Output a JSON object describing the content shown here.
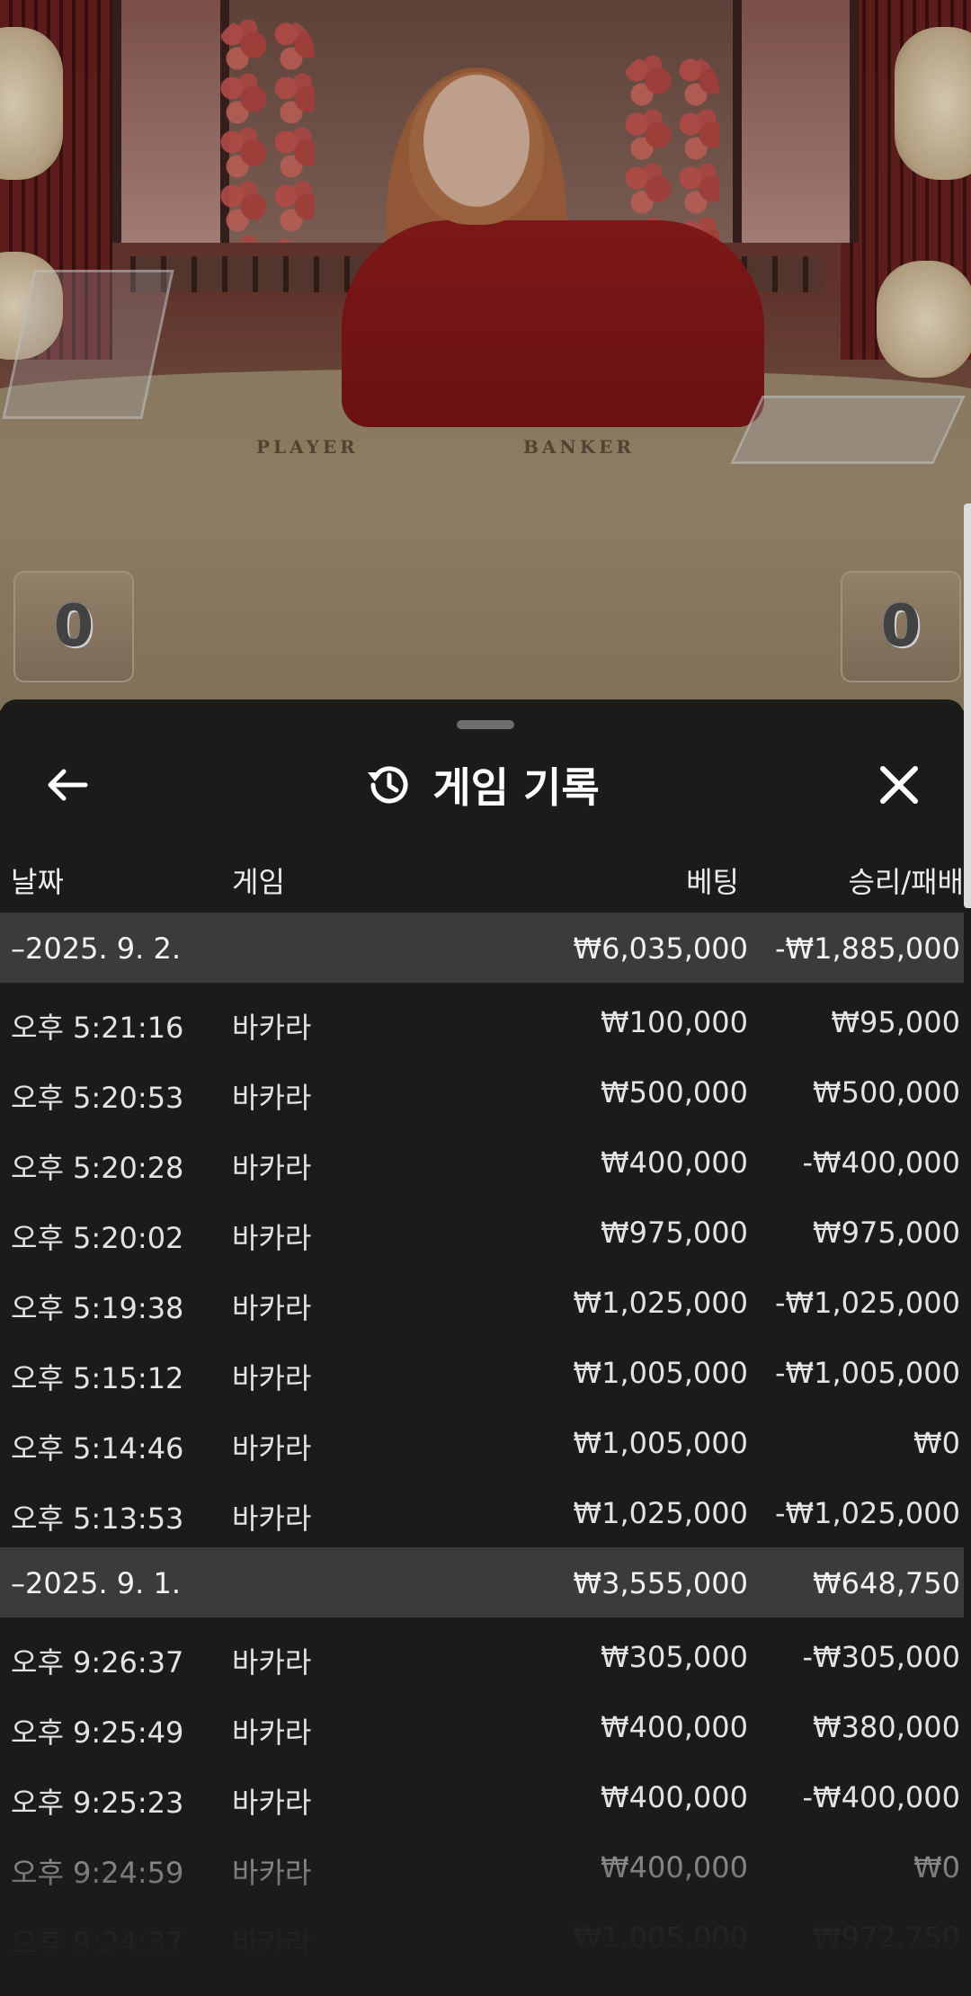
{
  "video": {
    "label_player": "PLAYER",
    "label_banker": "BANKER",
    "score_player": "0",
    "score_banker": "0"
  },
  "sheet": {
    "title": "게임 기록",
    "icons": {
      "back": "arrow-left-icon",
      "history": "history-icon",
      "close": "close-icon"
    },
    "columns": {
      "date": "날짜",
      "game": "게임",
      "bet": "베팅",
      "win_loss": "승리/패배"
    }
  },
  "rows": [
    {
      "type": "group",
      "date": "–2025. 9. 2.",
      "game": "",
      "bet": "₩6,035,000",
      "win": "-₩1,885,000"
    },
    {
      "type": "item",
      "date": "오후 5:21:16",
      "game": "바카라",
      "bet": "₩100,000",
      "win": "₩95,000"
    },
    {
      "type": "item",
      "date": "오후 5:20:53",
      "game": "바카라",
      "bet": "₩500,000",
      "win": "₩500,000"
    },
    {
      "type": "item",
      "date": "오후 5:20:28",
      "game": "바카라",
      "bet": "₩400,000",
      "win": "-₩400,000"
    },
    {
      "type": "item",
      "date": "오후 5:20:02",
      "game": "바카라",
      "bet": "₩975,000",
      "win": "₩975,000"
    },
    {
      "type": "item",
      "date": "오후 5:19:38",
      "game": "바카라",
      "bet": "₩1,025,000",
      "win": "-₩1,025,000"
    },
    {
      "type": "item",
      "date": "오후 5:15:12",
      "game": "바카라",
      "bet": "₩1,005,000",
      "win": "-₩1,005,000"
    },
    {
      "type": "item",
      "date": "오후 5:14:46",
      "game": "바카라",
      "bet": "₩1,005,000",
      "win": "₩0"
    },
    {
      "type": "item",
      "date": "오후 5:13:53",
      "game": "바카라",
      "bet": "₩1,025,000",
      "win": "-₩1,025,000"
    },
    {
      "type": "group",
      "date": "–2025. 9. 1.",
      "game": "",
      "bet": "₩3,555,000",
      "win": "₩648,750"
    },
    {
      "type": "item",
      "date": "오후 9:26:37",
      "game": "바카라",
      "bet": "₩305,000",
      "win": "-₩305,000"
    },
    {
      "type": "item",
      "date": "오후 9:25:49",
      "game": "바카라",
      "bet": "₩400,000",
      "win": "₩380,000"
    },
    {
      "type": "item",
      "date": "오후 9:25:23",
      "game": "바카라",
      "bet": "₩400,000",
      "win": "-₩400,000"
    },
    {
      "type": "item",
      "date": "오후 9:24:59",
      "game": "바카라",
      "bet": "₩400,000",
      "win": "₩0"
    },
    {
      "type": "item",
      "date": "오후 9:24:37",
      "game": "바카라",
      "bet": "₩1,005,000",
      "win": "₩972,750"
    }
  ]
}
